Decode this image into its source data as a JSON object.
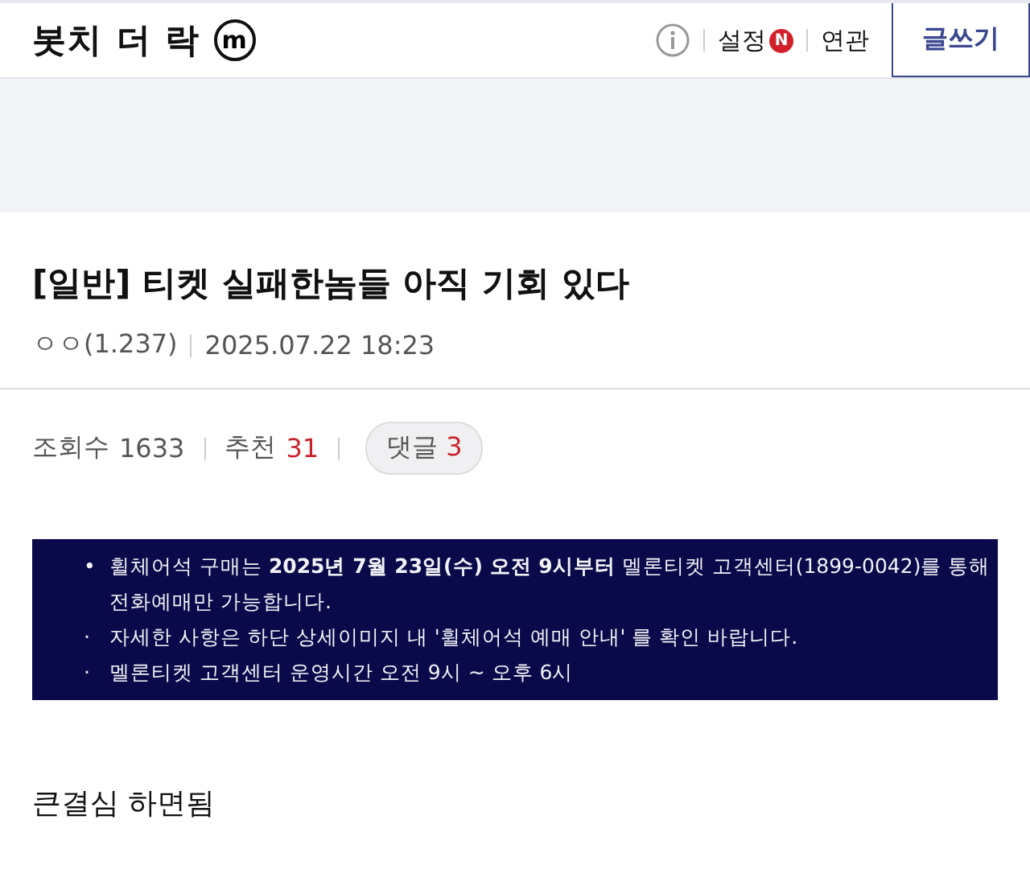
{
  "header": {
    "title": "봇치 더 락",
    "badge": "m",
    "links": [
      {
        "label": "설정",
        "new_badge": "N"
      },
      {
        "label": "연관"
      }
    ],
    "write_button": "글쓰기"
  },
  "post": {
    "title": "[일반] 티켓 실패한놈들 아직 기회 있다",
    "author": "ㅇㅇ(1.237)",
    "date": "2025.07.22 18:23",
    "views_label": "조회수",
    "views": "1633",
    "recommend_label": "추천",
    "recommend": "31",
    "comments_label": "댓글",
    "comments": "3"
  },
  "notice": {
    "lines": [
      {
        "marker": "•",
        "text": "휠체어석 구매는 **2025년 7월 23일(수) 오전 9시부터** 멜론티켓 고객센터(1899-0042)를 통해"
      },
      {
        "text": "전화예매만 가능합니다."
      },
      {
        "marker": "·",
        "text": "자세한 사항은 하단 상세이미지 내 '휠체어석 예매 안내' 를 확인 바랍니다."
      },
      {
        "marker": "·",
        "text": "멜론티켓 고객센터 운영시간 오전 9시 ~ 오후 6시"
      }
    ]
  },
  "body": "큰결심 하면됨"
}
